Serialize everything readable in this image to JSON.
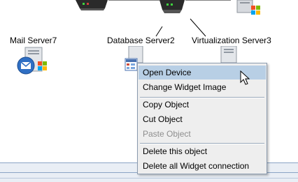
{
  "nodes": [
    {
      "label": "Mail Server7"
    },
    {
      "label": "Database Server2"
    },
    {
      "label": "Virtualization Server3"
    }
  ],
  "context_menu": {
    "items": [
      {
        "label": "Open Device"
      },
      {
        "label": "Change Widget Image"
      },
      {
        "label": "Copy Object"
      },
      {
        "label": "Cut Object"
      },
      {
        "label": "Paste Object"
      },
      {
        "label": "Delete this object"
      },
      {
        "label": "Delete all Widget connection"
      }
    ]
  },
  "colors": {
    "menu_background": "#eeeeee",
    "menu_highlight": "#b8cfe5",
    "disabled_text": "#8e8e8e"
  }
}
